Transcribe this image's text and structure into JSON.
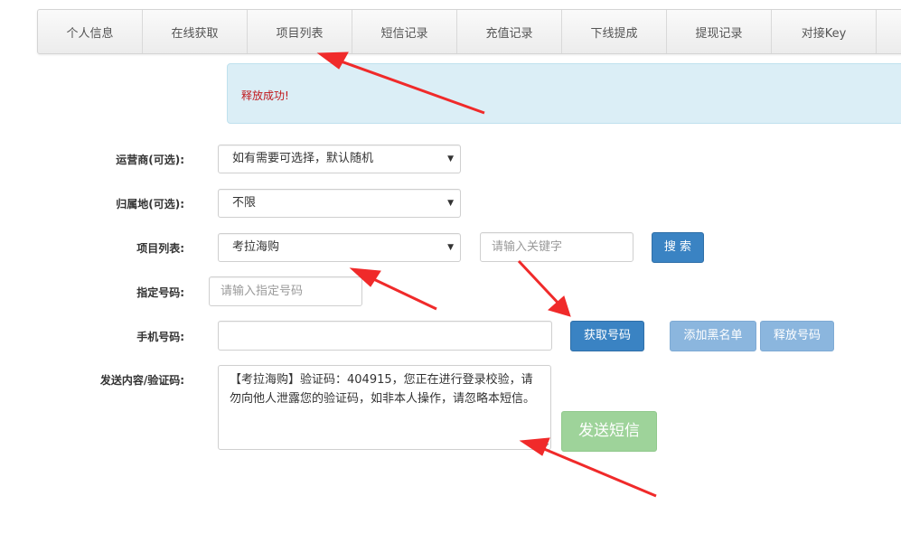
{
  "nav": {
    "tabs": [
      "个人信息",
      "在线获取",
      "项目列表",
      "短信记录",
      "充值记录",
      "下线提成",
      "提现记录",
      "对接Key"
    ]
  },
  "alert": {
    "message": "释放成功!"
  },
  "form": {
    "operator_label": "运营商(可选):",
    "operator_value": "如有需要可选择，默认随机",
    "region_label": "归属地(可选):",
    "region_value": "不限",
    "project_label": "项目列表:",
    "project_value": "考拉海购",
    "keyword_placeholder": "请输入关键字",
    "search_button": "搜 索",
    "specified_label": "指定号码:",
    "specified_placeholder": "请输入指定号码",
    "phone_label": "手机号码:",
    "phone_value": "",
    "get_number_button": "获取号码",
    "blacklist_button": "添加黑名单",
    "release_button": "释放号码",
    "content_label": "发送内容/验证码:",
    "content_value": "【考拉海购】验证码：404915，您正在进行登录校验，请勿向他人泄露您的验证码，如非本人操作，请忽略本短信。",
    "send_sms_button": "发送短信"
  },
  "colors": {
    "arrow": "#f02a2a",
    "primary": "#3a83c3",
    "alert_text": "#c0171b"
  }
}
